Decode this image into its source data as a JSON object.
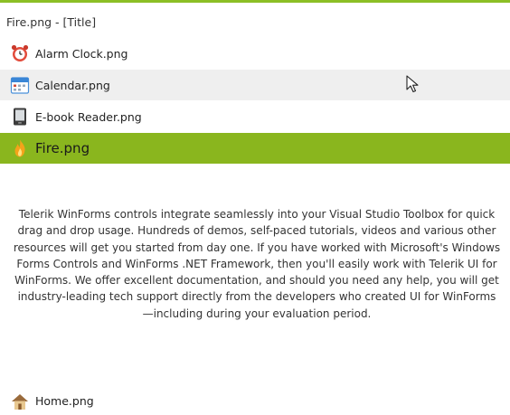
{
  "header": {
    "title": "Fire.png - [Title]"
  },
  "items": [
    {
      "label": "Alarm Clock.png",
      "icon": "alarm-clock-icon"
    },
    {
      "label": "Calendar.png",
      "icon": "calendar-icon"
    },
    {
      "label": "E-book Reader.png",
      "icon": "ebook-reader-icon"
    },
    {
      "label": "Fire.png",
      "icon": "fire-icon"
    },
    {
      "label": "Home.png",
      "icon": "home-icon"
    }
  ],
  "selected": {
    "description": "Telerik WinForms controls integrate seamlessly into your Visual Studio Toolbox for quick drag and drop usage. Hundreds of demos, self-paced tutorials, videos and various other resources will get you started from day one. If you have worked with Microsoft's Windows Forms Controls and WinForms .NET Framework, then you'll easily work with Telerik UI for WinForms. We offer excellent documentation, and should you need any help, you will get industry-leading tech support directly from the developers who created UI for WinForms—including during your evaluation period."
  },
  "colors": {
    "accent": "#8ab61e",
    "hover": "#efefef"
  }
}
